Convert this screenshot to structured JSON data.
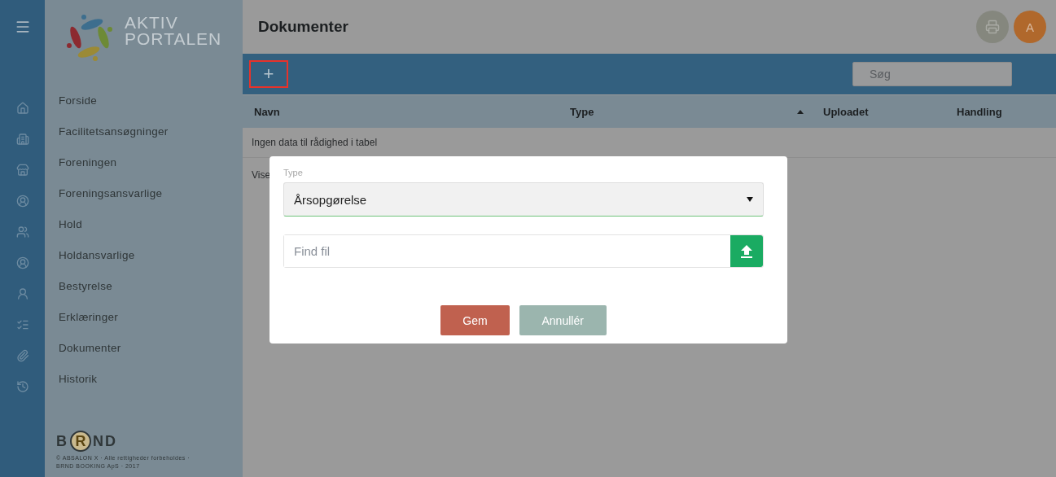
{
  "logo": {
    "lines": [
      "AKTIV",
      "PORTALEN"
    ]
  },
  "nav": [
    {
      "label": "Forside",
      "selected": false
    },
    {
      "label": "Facilitetsansøgninger",
      "selected": false
    },
    {
      "label": "Foreningen",
      "selected": false
    },
    {
      "label": "Foreningsansvarlige",
      "selected": false
    },
    {
      "label": "Hold",
      "selected": false
    },
    {
      "label": "Holdansvarlige",
      "selected": false
    },
    {
      "label": "Bestyrelse",
      "selected": false
    },
    {
      "label": "Erklæringer",
      "selected": false
    },
    {
      "label": "Dokumenter",
      "selected": false
    },
    {
      "label": "Historik",
      "selected": false
    }
  ],
  "footer": {
    "brand": [
      "B",
      "R",
      "ND"
    ],
    "copyright": [
      "© ABSALON X · Alle rettigheder forbeholdes ·",
      "BRND BOOKING ApS · 2017"
    ]
  },
  "header": {
    "title": "Dokumenter",
    "avatar": "A"
  },
  "toolbar": {
    "add": "+",
    "search": {
      "placeholder": "Søg"
    }
  },
  "table": {
    "columns": [
      {
        "label": "Navn",
        "sorted": false
      },
      {
        "label": "Type",
        "sorted": true
      },
      {
        "label": "Uploadet",
        "sorted": false
      },
      {
        "label": "Handling",
        "sorted": false
      }
    ],
    "empty": "Ingen data til rådighed i tabel",
    "info": "Vise"
  },
  "dialog": {
    "type_label": "Type",
    "type_value": "Årsopgørelse",
    "file": {
      "placeholder": "Find fil"
    },
    "buttons": [
      {
        "label": "Gem",
        "kind": "primary"
      },
      {
        "label": "Annullér",
        "kind": "secondary"
      }
    ]
  }
}
